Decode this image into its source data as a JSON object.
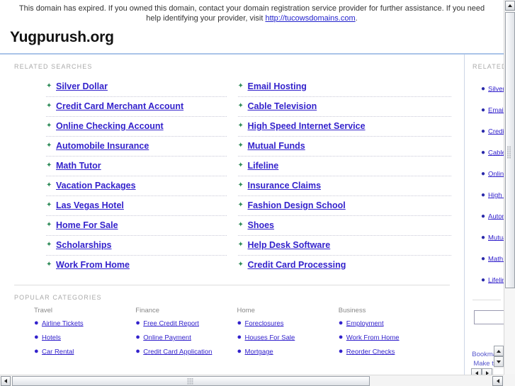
{
  "notice": {
    "text_before": "This domain has expired. If you owned this domain, contact your domain registration service provider for further assistance. If you need help identifying your provider, visit ",
    "link_text": "http://tucowsdomains.com",
    "text_after": "."
  },
  "header": {
    "domain_title": "Yugpurush.org"
  },
  "main": {
    "related_label": "RELATED SEARCHES",
    "related_left": [
      "Silver Dollar",
      "Credit Card Merchant Account",
      "Online Checking Account",
      "Automobile Insurance",
      "Math Tutor",
      "Vacation Packages",
      "Las Vegas Hotel",
      "Home For Sale",
      "Scholarships",
      "Work From Home"
    ],
    "related_right": [
      "Email Hosting",
      "Cable Television",
      "High Speed Internet Service",
      "Mutual Funds",
      "Lifeline",
      "Insurance Claims",
      "Fashion Design School",
      "Shoes",
      "Help Desk Software",
      "Credit Card Processing"
    ],
    "categories_label": "POPULAR CATEGORIES",
    "categories": [
      {
        "heading": "Travel",
        "items": [
          "Airline Tickets",
          "Hotels",
          "Car Rental"
        ]
      },
      {
        "heading": "Finance",
        "items": [
          "Free Credit Report",
          "Online Payment",
          "Credit Card Application"
        ]
      },
      {
        "heading": "Home",
        "items": [
          "Foreclosures",
          "Houses For Sale",
          "Mortgage"
        ]
      },
      {
        "heading": "Business",
        "items": [
          "Employment",
          "Work From Home",
          "Reorder Checks"
        ]
      }
    ]
  },
  "sidebar": {
    "label": "RELATED",
    "items": [
      "Silver Dollar",
      "Email Hosting",
      "Credit Card Merchant Account",
      "Cable Television",
      "Online Checking Account",
      "High Speed Internet Service",
      "Automobile Insurance",
      "Mutual Funds",
      "Math Tutor",
      "Lifeline"
    ],
    "search_value": "",
    "search_placeholder": "",
    "footer_links": [
      "Bookmark",
      "Make this"
    ]
  },
  "icons": {
    "arrow_bullet": "✦",
    "dot_bullet": "●"
  },
  "colors": {
    "link": "#3322cc",
    "arrow_bullet": "#2e8b57",
    "title_rule": "#aac4e8",
    "label_gray": "#aaaaaa"
  }
}
